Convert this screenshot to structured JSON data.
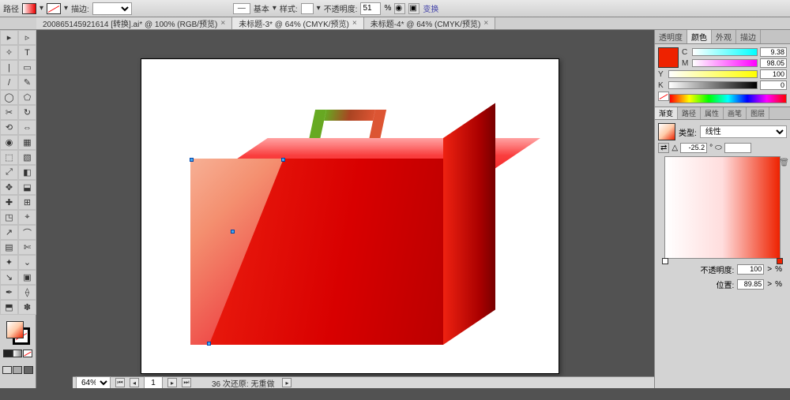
{
  "topbar": {
    "path_label": "路径",
    "stroke_label": "描边:",
    "stroke_weight": "",
    "brush_label": "基本",
    "style_label": "样式:",
    "opacity_label": "不透明度:",
    "opacity_value": "51",
    "opacity_suffix": "%",
    "transform_label": "变换"
  },
  "tabs": [
    {
      "label": "200865145921614 [转换].ai* @ 100% (RGB/预览)",
      "close": "×"
    },
    {
      "label": "未标题-3* @ 64% (CMYK/预览)",
      "close": "×"
    },
    {
      "label": "未标题-4* @ 64% (CMYK/预览)",
      "close": "×"
    }
  ],
  "bottombar": {
    "zoom": "64%",
    "page": "1",
    "status": "36 次还原: 无重做"
  },
  "color_panel": {
    "tabs": [
      "透明度",
      "颜色",
      "外观",
      "描边"
    ],
    "channels": [
      {
        "letter": "C",
        "val": "9.38"
      },
      {
        "letter": "M",
        "val": "98.05"
      },
      {
        "letter": "Y",
        "val": "100"
      },
      {
        "letter": "K",
        "val": "0"
      }
    ]
  },
  "mid_tabs": [
    "渐变",
    "路径",
    "属性",
    "画笔",
    "图层"
  ],
  "gradient_panel": {
    "type_label": "类型:",
    "type_value": "线性",
    "angle": "-25.2",
    "aspect": "",
    "opacity_label": "不透明度:",
    "opacity_value": "100",
    "opacity_suffix": "%",
    "location_label": "位置:",
    "location_value": "89.85",
    "location_suffix": "%"
  },
  "tools_glyphs": [
    "▸",
    "▹",
    "✧",
    "T",
    "|",
    "▭",
    "/",
    "✎",
    "◯",
    "⬠",
    "✂",
    "↻",
    "⟲",
    "⇔",
    "◉",
    "▦",
    "⬚",
    "▧",
    "⤢",
    "◧",
    "✥",
    "⬓",
    "✚",
    "⊞",
    "◳",
    "⌖",
    "↗",
    "⌒",
    "▤",
    "✄",
    "✦",
    "⌄",
    "↘",
    "▣",
    "✒",
    "⟠",
    "⬒",
    "✽"
  ]
}
